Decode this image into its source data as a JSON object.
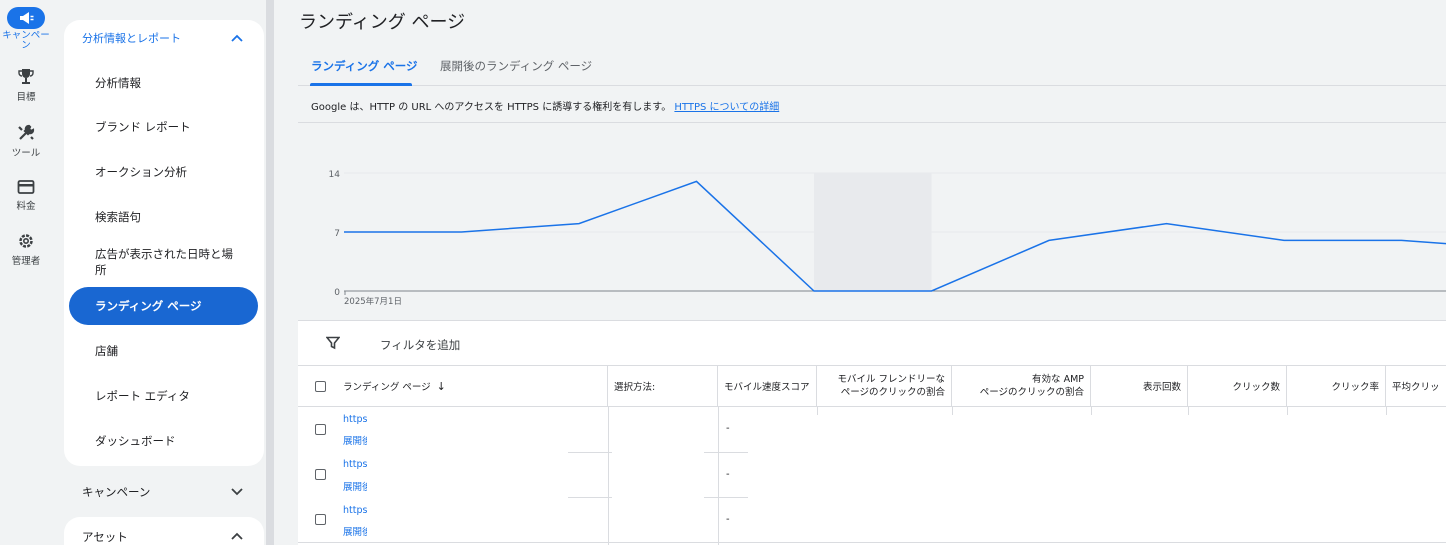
{
  "rail": {
    "items": [
      {
        "label": "キャンペーン",
        "icon": "megaphone-icon",
        "active": true
      },
      {
        "label": "目標",
        "icon": "trophy-icon"
      },
      {
        "label": "ツール",
        "icon": "tools-icon"
      },
      {
        "label": "料金",
        "icon": "credit-card-icon"
      },
      {
        "label": "管理者",
        "icon": "gear-icon"
      }
    ]
  },
  "nav": {
    "group_title": "分析情報とレポート",
    "items": [
      "分析情報",
      "ブランド レポート",
      "オークション分析",
      "検索語句",
      "広告が表示された日時と場所",
      "ランディング ページ",
      "店舗",
      "レポート エディタ",
      "ダッシュボード"
    ],
    "active_index": 5,
    "sections": [
      "キャンペーン",
      "アセット"
    ]
  },
  "page": {
    "title": "ランディング ページ",
    "tabs": [
      "ランディング ページ",
      "展開後のランディング ページ"
    ],
    "notice": "Google は、HTTP の URL へのアクセスを HTTPS に誘導する権利を有します。",
    "notice_link": "HTTPS についての詳細"
  },
  "chart_data": {
    "type": "line",
    "x_start_label": "2025年7月1日",
    "yticks": [
      "14",
      "7",
      "0"
    ],
    "ylim": [
      0,
      14
    ],
    "series": [
      {
        "values": [
          7,
          7,
          8,
          13,
          0,
          0,
          6,
          8,
          6,
          6,
          5
        ]
      }
    ],
    "highlight_band_index": 4,
    "color": "#1a73e8"
  },
  "filter": {
    "label": "フィルタを追加"
  },
  "table": {
    "columns": [
      "ランディング ページ",
      "選択方法:",
      "モバイル速度スコア",
      "モバイル フレンドリーなページのクリックの割合",
      "有効な AMP ページのクリックの割合",
      "表示回数",
      "クリック数",
      "クリック率",
      "平均クリッ"
    ],
    "col_mobile_friendly": [
      "モバイル フレンドリーな",
      "ページのクリックの割合"
    ],
    "col_amp": [
      "有効な AMP",
      "ページのクリックの割合"
    ],
    "sort_indicator": "↓",
    "rows": [
      {
        "url": "https:",
        "expanded": "展開後",
        "speed": "-"
      },
      {
        "url": "https:",
        "expanded": "展開後",
        "speed": "-"
      },
      {
        "url": "https:",
        "expanded": "展開後",
        "speed": "-"
      }
    ]
  }
}
